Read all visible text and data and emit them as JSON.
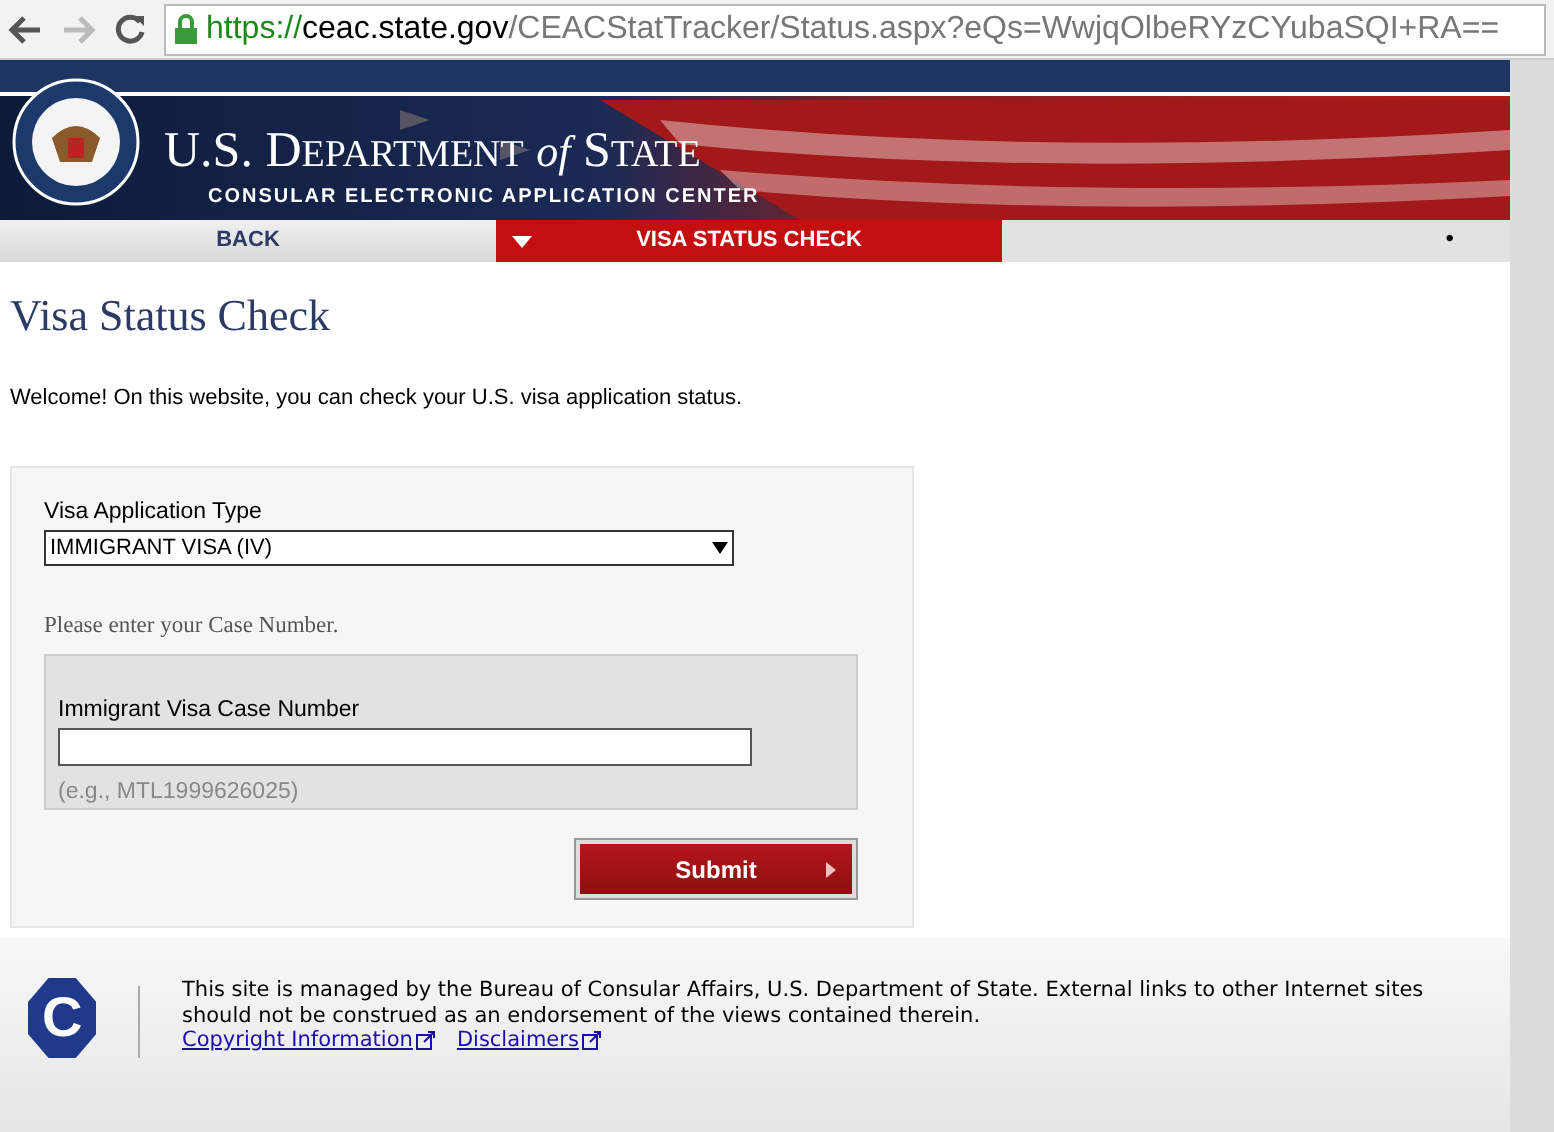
{
  "browser": {
    "url_scheme": "https://",
    "url_host": "ceac.state.gov",
    "url_path": "/CEACStatTracker/Status.aspx?eQs=WwjqOlbeRYzCYubaSQI+RA=="
  },
  "header": {
    "title_main": "U.S. D",
    "title_small1": "EPARTMENT",
    "title_of": "of",
    "title_s": "S",
    "title_small2": "TATE",
    "subtitle": "CONSULAR ELECTRONIC APPLICATION CENTER"
  },
  "nav": [
    {
      "label": "BACK",
      "selected": false
    },
    {
      "label": "VISA STATUS CHECK",
      "selected": true
    }
  ],
  "nav_bullet": "•",
  "page": {
    "title": "Visa Status Check",
    "welcome": "Welcome! On this website, you can check your U.S. visa application status."
  },
  "form": {
    "type_label": "Visa Application Type",
    "type_value": "IMMIGRANT VISA (IV)",
    "prompt": "Please enter your Case Number.",
    "case_label": "Immigrant Visa Case Number",
    "case_hint": "(e.g., MTL1999626025)",
    "submit": "Submit"
  },
  "footer": {
    "logo_letter": "C",
    "text": "This site is managed by the Bureau of Consular Affairs, U.S. Department of State. External links to other Internet sites should not be construed as an endorsement of the views contained therein.",
    "links": [
      "Copyright Information",
      "Disclaimers"
    ]
  }
}
